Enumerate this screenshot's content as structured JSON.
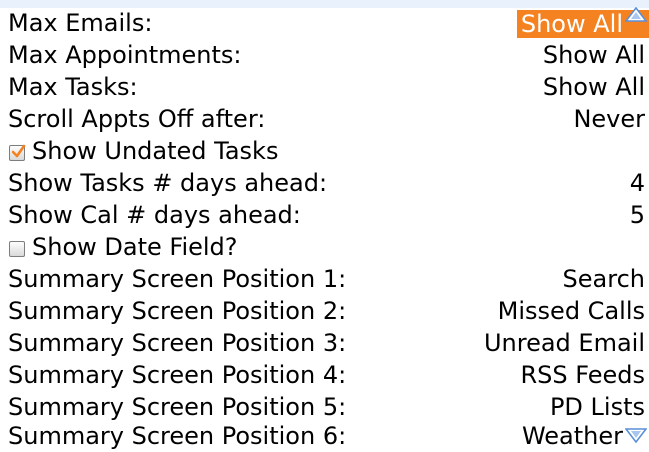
{
  "settings": [
    {
      "label": "Max Emails:",
      "value": "Show All",
      "selected": true
    },
    {
      "label": "Max Appointments:",
      "value": "Show All"
    },
    {
      "label": "Max Tasks:",
      "value": "Show All"
    },
    {
      "label": "Scroll Appts Off after:",
      "value": "Never"
    },
    {
      "label": "Show Undated Tasks",
      "checked": true
    },
    {
      "label": "Show Tasks # days ahead:",
      "value": "4"
    },
    {
      "label": "Show Cal # days ahead:",
      "value": "5"
    },
    {
      "label": "Show Date Field?",
      "checked": false
    },
    {
      "label": "Summary Screen Position 1:",
      "value": "Search"
    },
    {
      "label": "Summary Screen Position 2:",
      "value": "Missed Calls"
    },
    {
      "label": "Summary Screen Position 3:",
      "value": "Unread Email"
    },
    {
      "label": "Summary Screen Position 4:",
      "value": "RSS Feeds"
    },
    {
      "label": "Summary Screen Position 5:",
      "value": "PD Lists"
    },
    {
      "label": "Summary Screen Position 6:",
      "value": "Weather"
    }
  ],
  "colors": {
    "highlight": "#f58220",
    "arrow": "#5a8fd8"
  },
  "icons": {
    "scroll_up": "triangle-up-icon",
    "scroll_down": "triangle-down-icon",
    "check": "checkmark-icon"
  }
}
